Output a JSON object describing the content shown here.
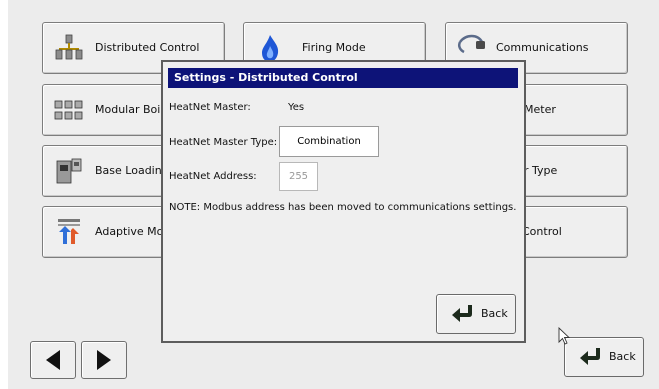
{
  "tiles": [
    {
      "label": "Distributed Control",
      "icon": "distributed-network-icon"
    },
    {
      "label": "Firing Mode",
      "icon": "flame-icon"
    },
    {
      "label": "Communications",
      "icon": "cable-icon"
    },
    {
      "label": "Modular Boil",
      "icon": "modular-boilers-icon"
    },
    {
      "label": "Meter"
    },
    {
      "label": "Base Loading",
      "icon": "base-loading-icon"
    },
    {
      "label": "r Type"
    },
    {
      "label": "Adaptive Mo",
      "icon": "adaptive-modulation-icon"
    },
    {
      "label": "Control"
    }
  ],
  "dialog": {
    "title": "Settings - Distributed Control",
    "master_label": "HeatNet Master:",
    "master_value": "Yes",
    "master_type_label": "HeatNet Master Type:",
    "master_type_value": "Combination",
    "address_label": "HeatNet Address:",
    "address_value": "255",
    "note": "NOTE: Modbus address has been moved to communications settings.",
    "back_label": "Back"
  },
  "footer": {
    "back_label": "Back",
    "prev_icon": "left-arrow-icon",
    "next_icon": "right-arrow-icon"
  },
  "colors": {
    "title_bar": "#0d1378",
    "back_arrow": "#1c2a1c"
  }
}
